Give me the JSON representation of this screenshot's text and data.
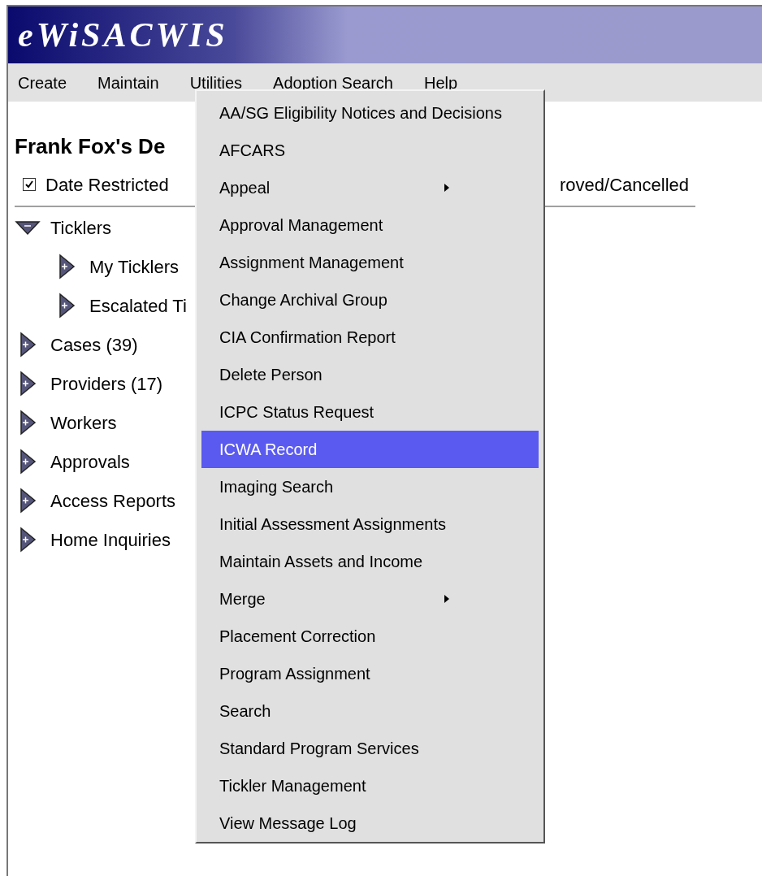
{
  "header": {
    "title": "eWiSACWIS"
  },
  "menu_bar": [
    {
      "label": "Create"
    },
    {
      "label": "Maintain"
    },
    {
      "label": "Utilities"
    },
    {
      "label": "Adoption Search"
    },
    {
      "label": "Help"
    }
  ],
  "page_title": "Frank Fox's De",
  "filters": {
    "date_restricted": {
      "label": "Date Restricted",
      "checked": true
    },
    "label_2": "roved/Cancelled"
  },
  "tree": [
    {
      "label": "Ticklers",
      "expanded": true,
      "children": [
        {
          "label": "My Ticklers",
          "expanded": false
        },
        {
          "label": "Escalated Ti",
          "expanded": false
        }
      ]
    },
    {
      "label": "Cases (39)",
      "expanded": false
    },
    {
      "label": "Providers (17)",
      "expanded": false
    },
    {
      "label": "Workers",
      "expanded": false
    },
    {
      "label": "Approvals",
      "expanded": false
    },
    {
      "label": "Access Reports",
      "expanded": false
    },
    {
      "label": "Home Inquiries",
      "expanded": false
    }
  ],
  "dropdown": [
    {
      "label": "AA/SG Eligibility Notices and Decisions",
      "submenu": false,
      "selected": false
    },
    {
      "label": "AFCARS",
      "submenu": false,
      "selected": false
    },
    {
      "label": "Appeal",
      "submenu": true,
      "selected": false
    },
    {
      "label": "Approval Management",
      "submenu": false,
      "selected": false
    },
    {
      "label": "Assignment Management",
      "submenu": false,
      "selected": false
    },
    {
      "label": "Change Archival Group",
      "submenu": false,
      "selected": false
    },
    {
      "label": "CIA Confirmation Report",
      "submenu": false,
      "selected": false
    },
    {
      "label": "Delete Person",
      "submenu": false,
      "selected": false
    },
    {
      "label": "ICPC Status Request",
      "submenu": false,
      "selected": false
    },
    {
      "label": "ICWA Record",
      "submenu": false,
      "selected": true
    },
    {
      "label": "Imaging Search",
      "submenu": false,
      "selected": false
    },
    {
      "label": "Initial Assessment Assignments",
      "submenu": false,
      "selected": false
    },
    {
      "label": "Maintain Assets and Income",
      "submenu": false,
      "selected": false
    },
    {
      "label": "Merge",
      "submenu": true,
      "selected": false
    },
    {
      "label": "Placement Correction",
      "submenu": false,
      "selected": false
    },
    {
      "label": "Program Assignment",
      "submenu": false,
      "selected": false
    },
    {
      "label": "Search",
      "submenu": false,
      "selected": false
    },
    {
      "label": "Standard Program Services",
      "submenu": false,
      "selected": false
    },
    {
      "label": "Tickler Management",
      "submenu": false,
      "selected": false
    },
    {
      "label": "View Message Log",
      "submenu": false,
      "selected": false
    }
  ]
}
